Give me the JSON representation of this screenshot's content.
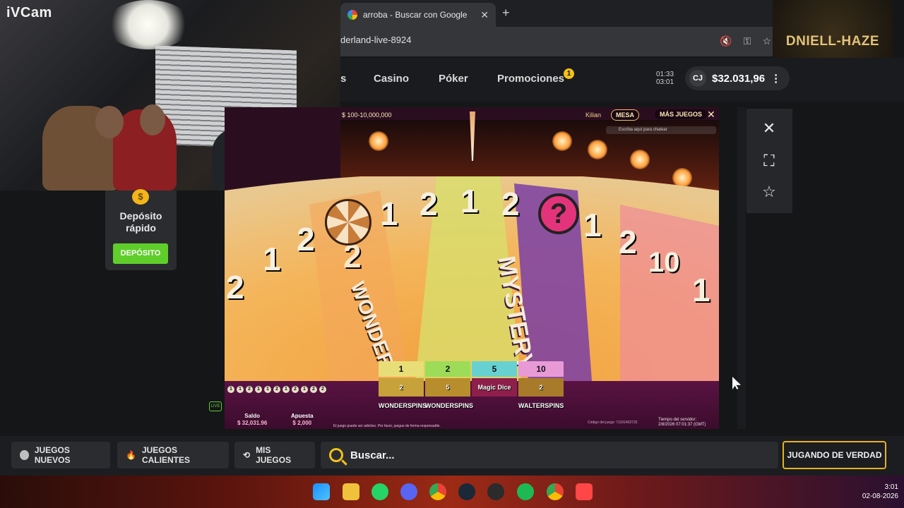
{
  "overlay": {
    "webcam_label": "iVCam",
    "streamer_name": "DNIELL-HAZE"
  },
  "browser": {
    "tab_title": "arroba - Buscar con Google",
    "url_fragment": "derland-live-8924"
  },
  "site_nav": {
    "items": [
      "s",
      "Casino",
      "Póker",
      "Promociones"
    ],
    "promo_badge": "1",
    "timer_top": "01:33",
    "timer_bottom": "03:01",
    "currency_badge": "CJ",
    "balance": "$32.031,96"
  },
  "deposit_card": {
    "coin_symbol": "$",
    "title": "Depósito rápido",
    "button": "DEPÓSITO"
  },
  "game": {
    "bet_range": "$ 100-10,000,000",
    "dealer": "Kilian",
    "mesa_label": "MESA",
    "mas_juegos_label": "MÁS JUEGOS",
    "chat_placeholder": "Escriba aquí para chatear",
    "wheel_segments": [
      "2",
      "1",
      "2",
      "2",
      "1",
      "2",
      "1",
      "2",
      "?",
      "1",
      "2",
      "10",
      "1"
    ],
    "mystery_label": "MYSTERY",
    "wonder_label": "WONDER",
    "bet_tops": [
      "1",
      "2",
      "5",
      "10"
    ],
    "bet_bottoms": [
      "2 WONDERSPINS",
      "5 WONDERSPINS",
      "Magic Dice",
      "2 WALTERSPINS"
    ],
    "history": [
      "1",
      "1",
      "2",
      "1",
      "1",
      "2",
      "1",
      "2",
      "1",
      "2",
      "2"
    ],
    "live_label": "LIVE",
    "saldo_label": "Saldo",
    "saldo_value": "$ 32,031.96",
    "apuesta_label": "Apuesta",
    "apuesta_value": "$ 2,000",
    "disclaimer": "El juego puede ser adictivo. Por favor, juegue de forma responsable.",
    "game_code": "Código del juego: 71191402732",
    "server_time_label": "Tiempo del servidor:",
    "server_time_value": "2/8/2026 07:01:37 (GMT)"
  },
  "bottom_bar": {
    "juegos_nuevos": "JUEGOS NUEVOS",
    "juegos_calientes": "JUEGOS CALIENTES",
    "mis_juegos": "MIS JUEGOS",
    "search_placeholder": "Buscar...",
    "real_play": "JUGANDO DE VERDAD"
  },
  "taskbar": {
    "time": "3:01",
    "date": "02-08-2026"
  },
  "colors": {
    "accent_green": "#5fce2a",
    "accent_gold": "#e7b21c",
    "bg": "#151618"
  }
}
